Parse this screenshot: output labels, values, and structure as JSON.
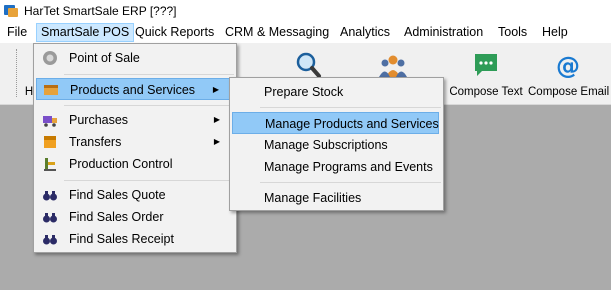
{
  "window": {
    "title": "HarTet SmartSale ERP [???]"
  },
  "menubar": {
    "items": [
      {
        "label": "File"
      },
      {
        "label": "SmartSale POS"
      },
      {
        "label": "Quick Reports"
      },
      {
        "label": "CRM & Messaging"
      },
      {
        "label": "Analytics"
      },
      {
        "label": "Administration"
      },
      {
        "label": "Tools"
      },
      {
        "label": "Help"
      }
    ]
  },
  "toolbar": {
    "buttons": [
      {
        "label": "H",
        "icon": "partial-icon"
      },
      {
        "label": "",
        "icon": "search-icon"
      },
      {
        "label": "",
        "icon": "people-icon"
      },
      {
        "label": "Compose Text",
        "icon": "chat-icon"
      },
      {
        "label": "Compose Email",
        "icon": "at-icon"
      }
    ]
  },
  "pos_menu": {
    "items": [
      {
        "label": "Point of Sale",
        "icon": "pos-icon"
      },
      {
        "label": "Products and Services",
        "icon": "products-icon",
        "submenu": true,
        "highlighted": true
      },
      {
        "label": "Purchases",
        "icon": "purchases-icon",
        "submenu": true
      },
      {
        "label": "Transfers",
        "icon": "transfers-icon",
        "submenu": true
      },
      {
        "label": "Production Control",
        "icon": "production-icon"
      },
      {
        "label": "Find Sales Quote",
        "icon": "binoculars-icon"
      },
      {
        "label": "Find Sales Order",
        "icon": "binoculars-icon"
      },
      {
        "label": "Find Sales Receipt",
        "icon": "binoculars-icon"
      }
    ]
  },
  "products_submenu": {
    "items": [
      {
        "label": "Prepare Stock"
      },
      {
        "label": "Manage Products and Services",
        "highlighted": true
      },
      {
        "label": "Manage Subscriptions"
      },
      {
        "label": "Manage Programs and Events"
      },
      {
        "label": "Manage Facilities"
      }
    ]
  },
  "colors": {
    "accent": "#0078d7",
    "highlight": "#91c9f7",
    "workspace": "#ababab",
    "chat_green": "#2e9c57"
  }
}
